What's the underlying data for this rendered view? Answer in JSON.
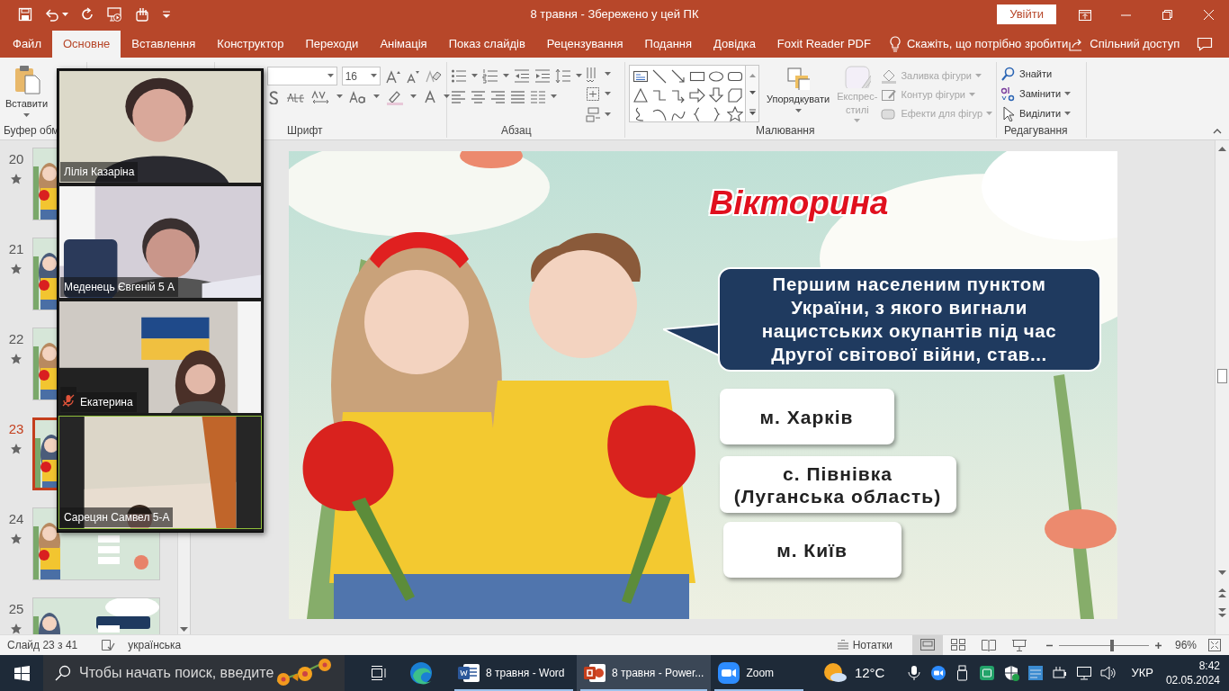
{
  "title_bar": {
    "title": "8 травня - Збережено у цей ПК",
    "sign_in": "Увійти"
  },
  "ribbon_tabs": [
    {
      "label": "Файл",
      "selected": false
    },
    {
      "label": "Основне",
      "selected": true
    },
    {
      "label": "Вставлення",
      "selected": false
    },
    {
      "label": "Конструктор",
      "selected": false
    },
    {
      "label": "Переходи",
      "selected": false
    },
    {
      "label": "Анімація",
      "selected": false
    },
    {
      "label": "Показ слайдів",
      "selected": false
    },
    {
      "label": "Рецензування",
      "selected": false
    },
    {
      "label": "Подання",
      "selected": false
    },
    {
      "label": "Довідка",
      "selected": false
    },
    {
      "label": "Foxit Reader PDF",
      "selected": false
    }
  ],
  "tell_me": "Скажіть, що потрібно зробити",
  "share": "Спільний доступ",
  "ribbon": {
    "clipboard": {
      "label": "Буфер обм",
      "paste": "Вставити"
    },
    "font": {
      "label": "Шрифт",
      "size": "16"
    },
    "paragraph": {
      "label": "Абзац"
    },
    "drawing": {
      "label": "Малювання",
      "arrange": "Упорядкувати",
      "quick_styles": {
        "label": "Експрес-стилі",
        "disabled": true
      },
      "commands": [
        {
          "label": "Заливка фігури",
          "kind": "fill",
          "disabled": true
        },
        {
          "label": "Контур фігури",
          "kind": "outline",
          "disabled": true
        },
        {
          "label": "Ефекти для фігур",
          "kind": "effects",
          "disabled": true
        }
      ]
    },
    "editing": {
      "label": "Редагування",
      "commands": [
        {
          "label": "Знайти",
          "kind": "find",
          "dropdown": false
        },
        {
          "label": "Замінити",
          "kind": "replace",
          "dropdown": true
        },
        {
          "label": "Виділити",
          "kind": "select",
          "dropdown": true
        }
      ]
    }
  },
  "slide_thumbnails": [
    {
      "number": "20",
      "selected": false
    },
    {
      "number": "21",
      "selected": false
    },
    {
      "number": "22",
      "selected": false
    },
    {
      "number": "23",
      "selected": true
    },
    {
      "number": "24",
      "selected": false
    },
    {
      "number": "25",
      "selected": false
    }
  ],
  "slide": {
    "title": "Вікторина",
    "question": "Першим населеним пунктом України, з якого вигнали нацистських окупантів під час Другої світової війни, став...",
    "answers": [
      "м. Харків",
      "с. Півнівка (Луганська область)",
      "м. Київ"
    ]
  },
  "video_call": {
    "participants": [
      {
        "name": "Лілія Казаріна",
        "muted": false,
        "active_speaker": false
      },
      {
        "name": "Меденець Євгеній 5 А",
        "muted": false,
        "active_speaker": false
      },
      {
        "name": "Екатерина",
        "muted": true,
        "active_speaker": false
      },
      {
        "name": "Сарецян Самвел 5-А",
        "muted": false,
        "active_speaker": true
      }
    ]
  },
  "status_bar": {
    "slide_position": "Слайд 23 з 41",
    "language": "українська",
    "notes": "Нотатки",
    "views": [
      {
        "selected": true
      },
      {
        "selected": false
      },
      {
        "selected": false
      },
      {
        "selected": false
      }
    ],
    "zoom_slider": {
      "level": 0.59
    },
    "zoom": "96%"
  },
  "taskbar": {
    "search_placeholder": "Чтобы начать поиск, введите",
    "apps": [
      {
        "label": "8 травня - Word",
        "kind": "word",
        "active": false
      },
      {
        "label": "8 травня - Power...",
        "kind": "powerpoint",
        "active": true
      },
      {
        "label": "Zoom",
        "kind": "zoom",
        "active": false
      }
    ],
    "weather": "12°C",
    "language": "УКР",
    "time": "8:42",
    "date": "02.05.2024"
  }
}
